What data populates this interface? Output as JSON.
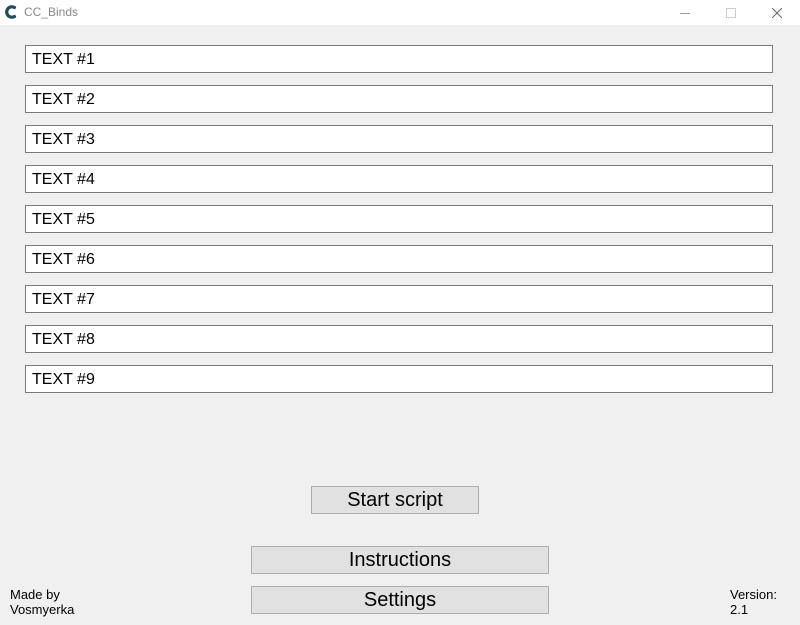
{
  "window": {
    "title": "CC_Binds",
    "icon": "app-logo-icon",
    "controls": [
      "minimize-icon",
      "maximize-icon",
      "close-icon"
    ]
  },
  "fields": [
    {
      "value": "TEXT #1"
    },
    {
      "value": "TEXT #2"
    },
    {
      "value": "TEXT #3"
    },
    {
      "value": "TEXT #4"
    },
    {
      "value": "TEXT #5"
    },
    {
      "value": "TEXT #6"
    },
    {
      "value": "TEXT #7"
    },
    {
      "value": "TEXT #8"
    },
    {
      "value": "TEXT #9"
    }
  ],
  "buttons": {
    "start": "Start script",
    "instructions": "Instructions",
    "settings": "Settings"
  },
  "footer": {
    "made_by_label": "Made by",
    "author": "Vosmyerka",
    "version_label": "Version:",
    "version_value": "2.1"
  },
  "colors": {
    "window_bg": "#f0f0f0",
    "titlebar_bg": "#ffffff",
    "button_bg": "#e1e1e1",
    "field_border": "#7a7a7a",
    "icon_color": "#1f4e5a"
  }
}
